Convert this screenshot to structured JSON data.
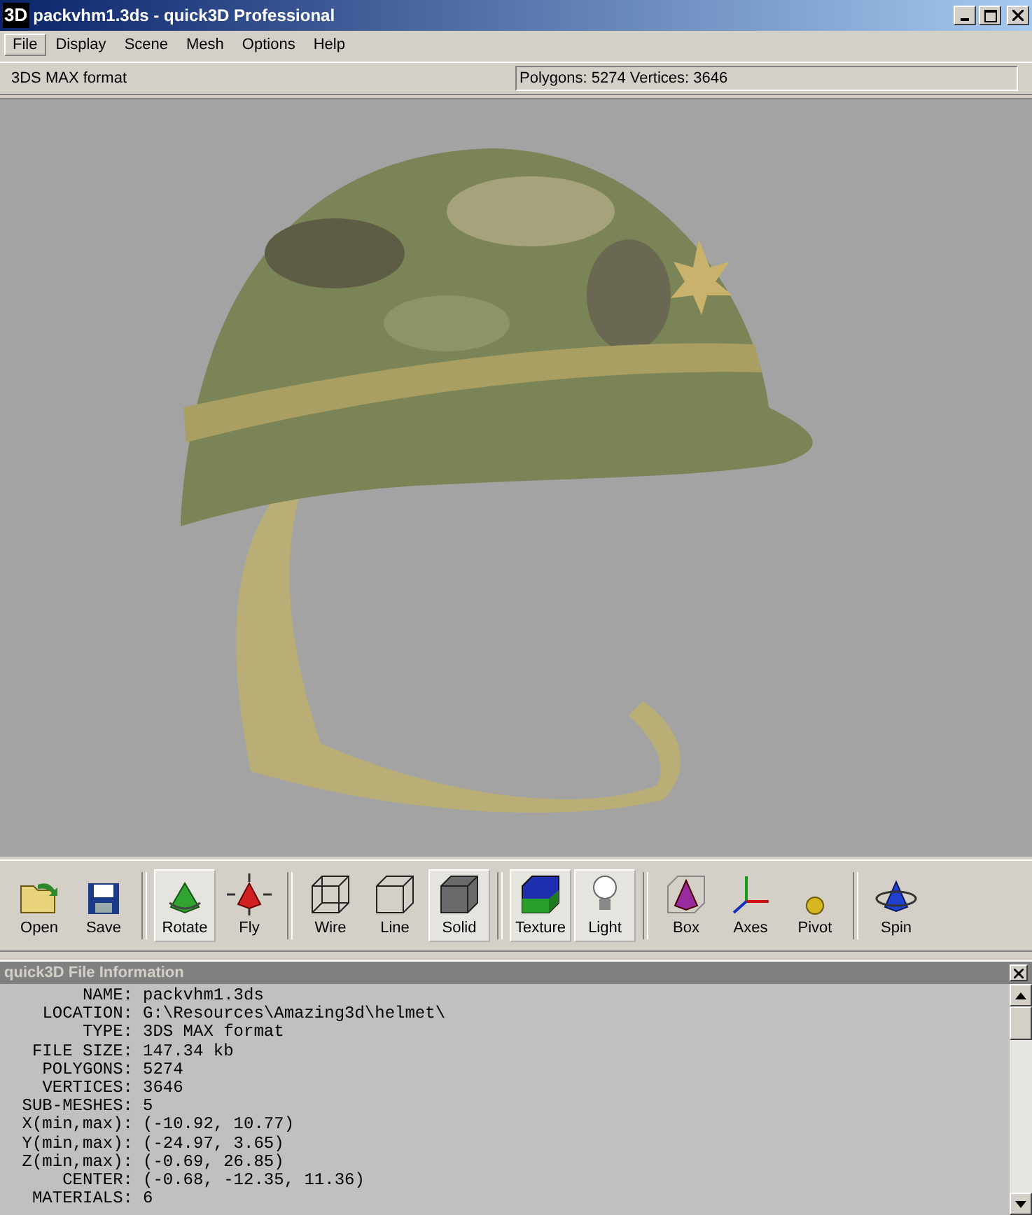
{
  "window": {
    "logo": "3D",
    "title": "packvhm1.3ds - quick3D Professional"
  },
  "menu": [
    {
      "label": "File",
      "selected": true
    },
    {
      "label": "Display",
      "selected": false
    },
    {
      "label": "Scene",
      "selected": false
    },
    {
      "label": "Mesh",
      "selected": false
    },
    {
      "label": "Options",
      "selected": false
    },
    {
      "label": "Help",
      "selected": false
    }
  ],
  "info_bar": {
    "format": "3DS MAX format",
    "stats": "Polygons: 5274  Vertices: 3646"
  },
  "toolbar": [
    [
      {
        "label": "Open",
        "kind": "open",
        "selected": false
      },
      {
        "label": "Save",
        "kind": "save",
        "selected": false
      }
    ],
    [
      {
        "label": "Rotate",
        "kind": "rotate",
        "selected": true
      },
      {
        "label": "Fly",
        "kind": "fly",
        "selected": false
      }
    ],
    [
      {
        "label": "Wire",
        "kind": "wire",
        "selected": false
      },
      {
        "label": "Line",
        "kind": "line",
        "selected": false
      },
      {
        "label": "Solid",
        "kind": "solid",
        "selected": true
      }
    ],
    [
      {
        "label": "Texture",
        "kind": "texture",
        "selected": true
      },
      {
        "label": "Light",
        "kind": "light",
        "selected": true
      }
    ],
    [
      {
        "label": "Box",
        "kind": "box",
        "selected": false
      },
      {
        "label": "Axes",
        "kind": "axes",
        "selected": false
      },
      {
        "label": "Pivot",
        "kind": "pivot",
        "selected": false
      }
    ],
    [
      {
        "label": "Spin",
        "kind": "spin",
        "selected": false
      }
    ]
  ],
  "file_info": {
    "title": "quick3D File Information",
    "rows": [
      {
        "label": "NAME:",
        "value": "packvhm1.3ds"
      },
      {
        "label": "LOCATION:",
        "value": "G:\\Resources\\Amazing3d\\helmet\\"
      },
      {
        "label": "TYPE:",
        "value": "3DS MAX format"
      },
      {
        "label": "FILE SIZE:",
        "value": "147.34 kb"
      },
      {
        "label": "POLYGONS:",
        "value": "5274"
      },
      {
        "label": "VERTICES:",
        "value": "3646"
      },
      {
        "label": "SUB-MESHES:",
        "value": "5"
      },
      {
        "label": "X(min,max):",
        "value": "(-10.92, 10.77)"
      },
      {
        "label": "Y(min,max):",
        "value": "(-24.97, 3.65)"
      },
      {
        "label": "Z(min,max):",
        "value": "(-0.69, 26.85)"
      },
      {
        "label": "CENTER:",
        "value": "(-0.68, -12.35, 11.36)"
      },
      {
        "label": "MATERIALS:",
        "value": "6"
      }
    ]
  }
}
